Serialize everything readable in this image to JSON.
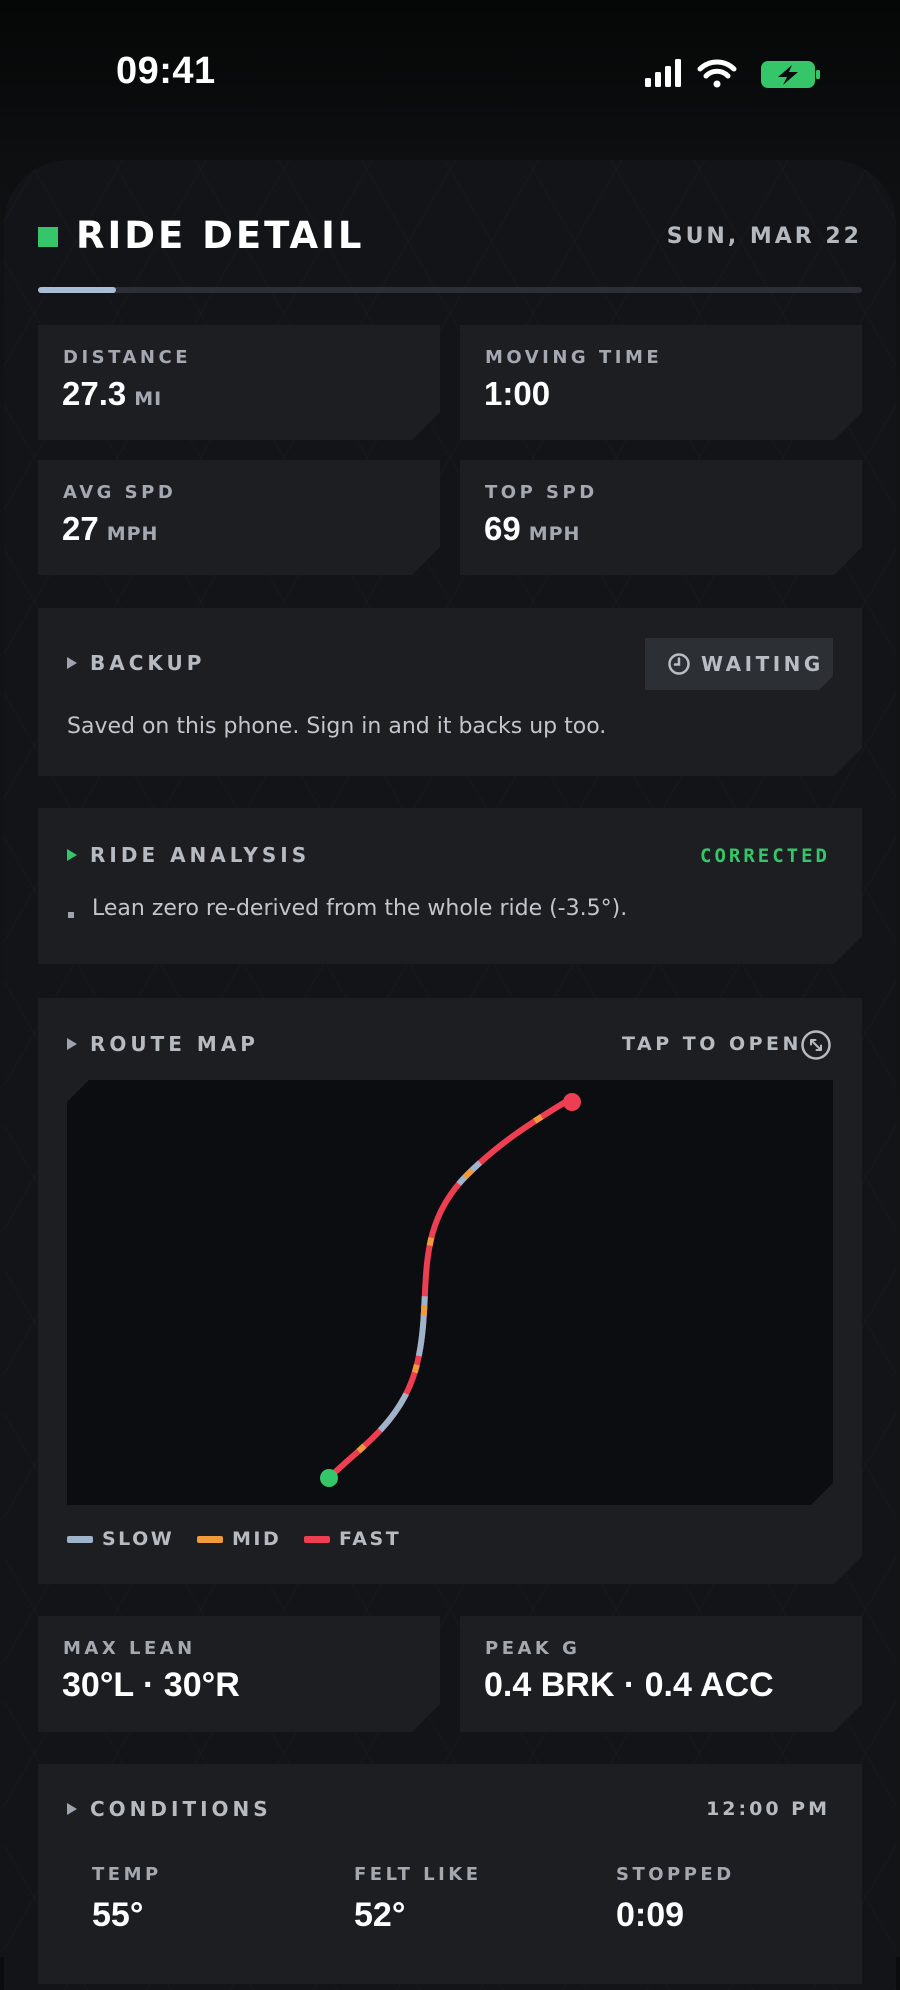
{
  "status_bar": {
    "time": "09:41"
  },
  "header": {
    "title": "RIDE DETAIL",
    "date": "SUN, MAR 22",
    "progress": 0.095
  },
  "stats": {
    "distance": {
      "label": "DISTANCE",
      "value": "27.3",
      "unit": "MI"
    },
    "moving_time": {
      "label": "MOVING TIME",
      "value": "1:00"
    },
    "avg_speed": {
      "label": "AVG SPD",
      "value": "27",
      "unit": "MPH"
    },
    "top_speed": {
      "label": "TOP SPD",
      "value": "69",
      "unit": "MPH"
    }
  },
  "backup": {
    "title": "BACKUP",
    "badge": "WAITING",
    "badge_icon": "clock-icon",
    "message": "Saved on this phone. Sign in and it backs up too."
  },
  "ride_analysis": {
    "title": "RIDE ANALYSIS",
    "status": "CORRECTED",
    "bullets": [
      "Lean zero re-derived from the whole ride (-3.5°)."
    ]
  },
  "route_map": {
    "title": "ROUTE MAP",
    "action": "TAP TO OPEN",
    "action_icon": "expand-icon",
    "legend": [
      {
        "label": "SLOW",
        "color": "#9fb3cb"
      },
      {
        "label": "MID",
        "color": "#f19a3a"
      },
      {
        "label": "FAST",
        "color": "#ee3f52"
      }
    ],
    "start_color": "#35c66a",
    "end_color": "#ee3f52"
  },
  "max_lean": {
    "label": "MAX LEAN",
    "value": "30°L · 30°R"
  },
  "peak_g": {
    "label": "PEAK G",
    "value": "0.4 BRK · 0.4 ACC"
  },
  "conditions": {
    "title": "CONDITIONS",
    "time": "12:00 PM",
    "items": [
      {
        "label": "TEMP",
        "value": "55°"
      },
      {
        "label": "FELT LIKE",
        "value": "52°"
      },
      {
        "label": "STOPPED",
        "value": "0:09"
      }
    ]
  },
  "colors": {
    "accent_green": "#35c66a",
    "card": "#1c1e22",
    "background": "#121417"
  }
}
